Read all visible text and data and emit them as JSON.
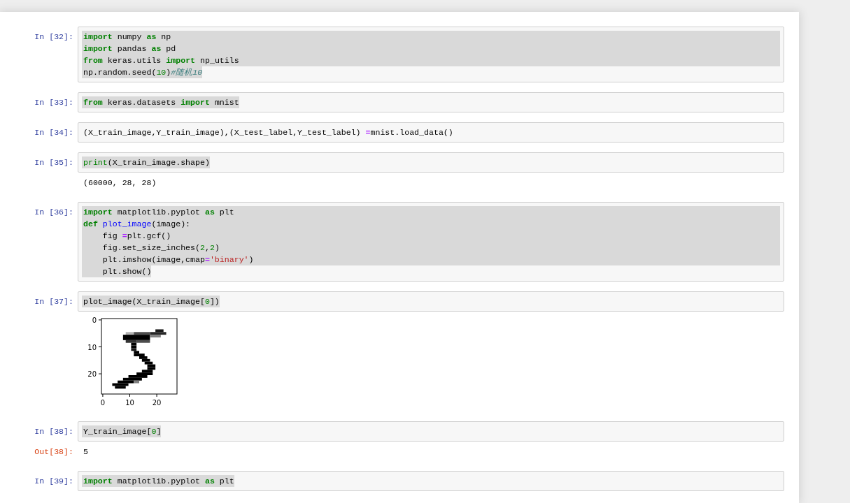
{
  "cells": [
    {
      "prompt": "In [32]:",
      "selection": true,
      "lines": [
        {
          "tokens": [
            {
              "text": "import",
              "kind": "kw"
            },
            {
              "text": " numpy ",
              "kind": "plain"
            },
            {
              "text": "as",
              "kind": "kw"
            },
            {
              "text": " np",
              "kind": "plain"
            }
          ]
        },
        {
          "tokens": [
            {
              "text": "import",
              "kind": "kw"
            },
            {
              "text": " pandas ",
              "kind": "plain"
            },
            {
              "text": "as",
              "kind": "kw"
            },
            {
              "text": " pd",
              "kind": "plain"
            }
          ]
        },
        {
          "tokens": [
            {
              "text": "from",
              "kind": "kw"
            },
            {
              "text": " keras.utils ",
              "kind": "plain"
            },
            {
              "text": "import",
              "kind": "kw"
            },
            {
              "text": " np_utils",
              "kind": "plain"
            }
          ]
        },
        {
          "tokens": [
            {
              "text": "np.random.seed(",
              "kind": "plain"
            },
            {
              "text": "10",
              "kind": "num"
            },
            {
              "text": ")",
              "kind": "plain"
            },
            {
              "text": "#随机10",
              "kind": "comment"
            }
          ]
        }
      ]
    },
    {
      "prompt": "In [33]:",
      "selection": true,
      "lines": [
        {
          "tokens": [
            {
              "text": "from",
              "kind": "kw"
            },
            {
              "text": " keras.datasets ",
              "kind": "plain"
            },
            {
              "text": "import",
              "kind": "kw"
            },
            {
              "text": " mnist",
              "kind": "plain"
            }
          ]
        }
      ]
    },
    {
      "prompt": "In [34]:",
      "selection": false,
      "lines": [
        {
          "tokens": [
            {
              "text": "(X_train_image,Y_train_image),(X_test_label,Y_test_label) ",
              "kind": "plain"
            },
            {
              "text": "=",
              "kind": "op"
            },
            {
              "text": "mnist.load_data()",
              "kind": "plain"
            }
          ]
        }
      ]
    },
    {
      "prompt": "In [35]:",
      "selection": true,
      "lines": [
        {
          "tokens": [
            {
              "text": "print",
              "kind": "builtin"
            },
            {
              "text": "(X_train_image.shape)",
              "kind": "plain"
            }
          ]
        }
      ],
      "outputs": [
        {
          "kind": "stream",
          "text": "(60000, 28, 28)"
        }
      ]
    },
    {
      "prompt": "In [36]:",
      "selection": true,
      "lines": [
        {
          "tokens": [
            {
              "text": "import",
              "kind": "kw"
            },
            {
              "text": " matplotlib.pyplot ",
              "kind": "plain"
            },
            {
              "text": "as",
              "kind": "kw"
            },
            {
              "text": " plt",
              "kind": "plain"
            }
          ]
        },
        {
          "tokens": [
            {
              "text": "def ",
              "kind": "kw"
            },
            {
              "text": "plot_image",
              "kind": "fn"
            },
            {
              "text": "(image):",
              "kind": "plain"
            }
          ]
        },
        {
          "tokens": [
            {
              "text": "    fig ",
              "kind": "plain"
            },
            {
              "text": "=",
              "kind": "op"
            },
            {
              "text": "plt.gcf()",
              "kind": "plain"
            }
          ]
        },
        {
          "tokens": [
            {
              "text": "    fig.set_size_inches(",
              "kind": "plain"
            },
            {
              "text": "2",
              "kind": "num"
            },
            {
              "text": ",",
              "kind": "plain"
            },
            {
              "text": "2",
              "kind": "num"
            },
            {
              "text": ")",
              "kind": "plain"
            }
          ]
        },
        {
          "tokens": [
            {
              "text": "    plt.imshow(image,cmap",
              "kind": "plain"
            },
            {
              "text": "=",
              "kind": "op"
            },
            {
              "text": "'binary'",
              "kind": "str"
            },
            {
              "text": ")",
              "kind": "plain"
            }
          ]
        },
        {
          "tokens": [
            {
              "text": "    plt.show()",
              "kind": "plain"
            }
          ]
        }
      ]
    },
    {
      "prompt": "In [37]:",
      "selection": true,
      "lines": [
        {
          "tokens": [
            {
              "text": "plot_image(X_train_image[",
              "kind": "plain"
            },
            {
              "text": "0",
              "kind": "num"
            },
            {
              "text": "])",
              "kind": "plain"
            }
          ]
        }
      ],
      "outputs": [
        {
          "kind": "figure",
          "yticks": [
            "0",
            "10",
            "20"
          ],
          "xticks": [
            "0",
            "10",
            "20"
          ]
        }
      ]
    },
    {
      "prompt": "In [38]:",
      "selection": true,
      "lines": [
        {
          "tokens": [
            {
              "text": "Y_train_image[",
              "kind": "plain"
            },
            {
              "text": "0",
              "kind": "num"
            },
            {
              "text": "]",
              "kind": "plain"
            }
          ]
        }
      ],
      "outputs": [
        {
          "kind": "result",
          "prompt": "Out[38]:",
          "text": "5"
        }
      ]
    },
    {
      "prompt": "In [39]:",
      "selection": true,
      "lines": [
        {
          "tokens": [
            {
              "text": "import",
              "kind": "kw"
            },
            {
              "text": " matplotlib.pyplot ",
              "kind": "plain"
            },
            {
              "text": "as",
              "kind": "kw"
            },
            {
              "text": " plt",
              "kind": "plain"
            }
          ]
        }
      ]
    }
  ]
}
